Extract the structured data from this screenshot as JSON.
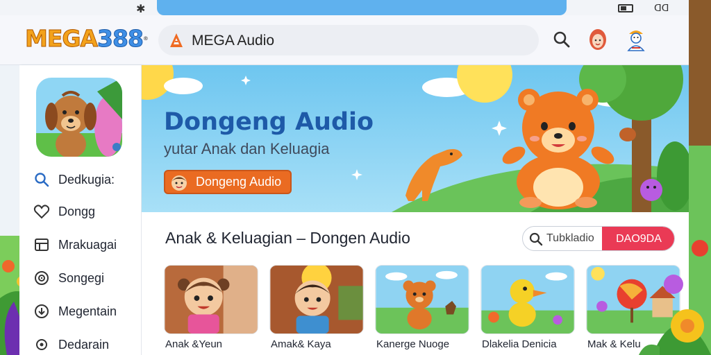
{
  "status_bar": {
    "left_glyph": "✱",
    "right_text": "ᗡᗡ"
  },
  "header": {
    "logo": {
      "part1": "MEGA",
      "part2": "388",
      "mark": "®"
    },
    "search": {
      "text": "MEGA Audio"
    },
    "icons": [
      "search-icon",
      "avatar-icon",
      "profile-icon"
    ]
  },
  "sidebar": {
    "items": [
      {
        "label": "Dedkugia:",
        "icon": "search-icon"
      },
      {
        "label": "Dongg",
        "icon": "heart-icon"
      },
      {
        "label": "Mrakuagai",
        "icon": "library-icon"
      },
      {
        "label": "Songegi",
        "icon": "audio-icon"
      },
      {
        "label": "Megentain",
        "icon": "download-icon"
      },
      {
        "label": "Dedarain",
        "icon": "settings-icon"
      }
    ]
  },
  "hero": {
    "title": "Dongeng Audio",
    "subtitle": "yutar Anak dan Keluagia",
    "button_label": "Dongeng Audio"
  },
  "content": {
    "section_title": "Anak & Keluagian – Dongen Audio",
    "filter": {
      "input_text": "Tubkladio",
      "button_label": "DAO9DA"
    },
    "cards": [
      {
        "title": "Anak &Yeun"
      },
      {
        "title": "Amak& Kaya"
      },
      {
        "title": "Kanerge Nuoge"
      },
      {
        "title": "Dlakelia Denicia"
      },
      {
        "title": "Mak & Kelu"
      }
    ]
  },
  "colors": {
    "hero_title": "#1e5aa8",
    "accent_orange": "#ea6b22",
    "accent_red": "#ea3a55",
    "sky": "#7fcdf2"
  }
}
